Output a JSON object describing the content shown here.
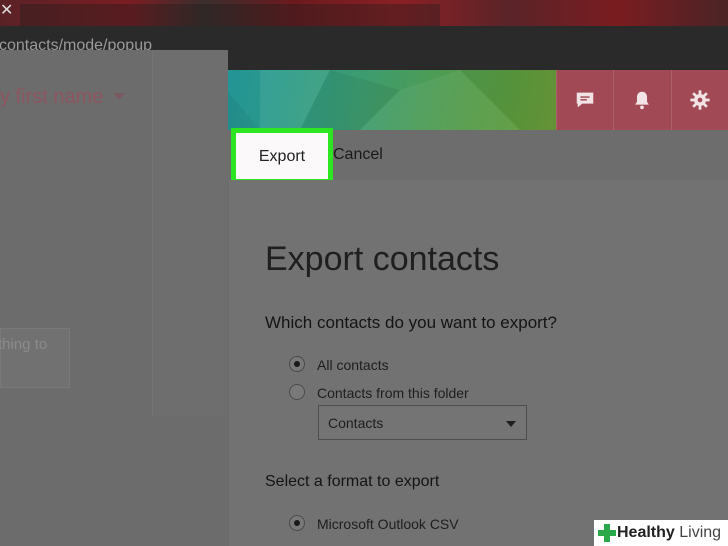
{
  "browser": {
    "close_glyph": "✕",
    "url": "contacts/mode/popup"
  },
  "header": {
    "icons": [
      "chat-icon",
      "bell-icon",
      "gear-icon"
    ],
    "accent_color": "#a14a56"
  },
  "left_pane": {
    "sort_label": "y first name",
    "search_text": "thing to"
  },
  "command_bar": {
    "export_label": "Export",
    "cancel_label": "Cancel",
    "highlight_color": "#2de61f"
  },
  "export_panel": {
    "title": "Export contacts",
    "question_contacts": "Which contacts do you want to export?",
    "options": [
      {
        "label": "All contacts",
        "selected": true
      },
      {
        "label": "Contacts from this folder",
        "selected": false
      }
    ],
    "folder_select": {
      "value": "Contacts"
    },
    "question_format": "Select a format to export",
    "format_options": [
      {
        "label": "Microsoft Outlook CSV",
        "selected": true
      }
    ]
  },
  "watermark": {
    "brand_bold": "Healthy",
    "brand_light": "Living"
  }
}
